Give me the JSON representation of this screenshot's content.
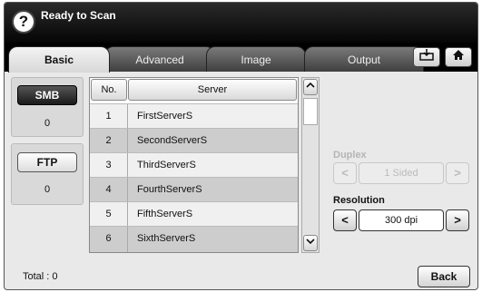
{
  "header": {
    "title": "Ready to Scan",
    "help_icon": "?"
  },
  "tabs": [
    {
      "label": "Basic",
      "active": true
    },
    {
      "label": "Advanced",
      "active": false
    },
    {
      "label": "Image",
      "active": false
    },
    {
      "label": "Output",
      "active": false
    }
  ],
  "toolbar": {
    "job_icon": "job-status-icon",
    "home_icon": "home-icon"
  },
  "protocols": [
    {
      "label": "SMB",
      "count": "0",
      "selected": true
    },
    {
      "label": "FTP",
      "count": "0",
      "selected": false
    }
  ],
  "server_table": {
    "columns": [
      "No.",
      "Server"
    ],
    "rows": [
      {
        "no": "1",
        "server": "FirstServerS"
      },
      {
        "no": "2",
        "server": "SecondServerS"
      },
      {
        "no": "3",
        "server": "ThirdServerS"
      },
      {
        "no": "4",
        "server": "FourthServerS"
      },
      {
        "no": "5",
        "server": "FifthServerS"
      },
      {
        "no": "6",
        "server": "SixthServerS"
      }
    ]
  },
  "scrollbar": {
    "up_icon": "chevron-up-icon",
    "down_icon": "chevron-down-icon"
  },
  "duplex": {
    "label": "Duplex",
    "value": "1 Sided",
    "enabled": false
  },
  "resolution": {
    "label": "Resolution",
    "value": "300 dpi",
    "enabled": true
  },
  "spin_glyphs": {
    "left": "<",
    "right": ">"
  },
  "footer": {
    "total": "Total : 0",
    "back_label": "Back"
  }
}
